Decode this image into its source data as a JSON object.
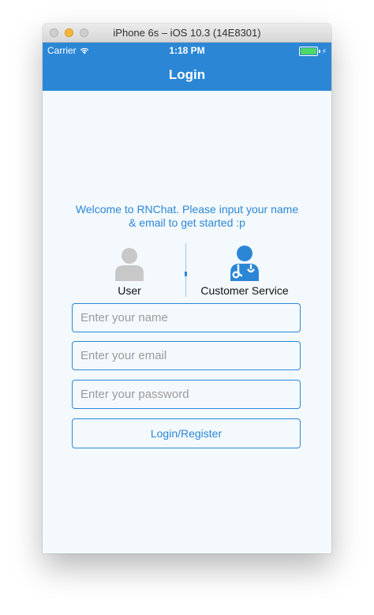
{
  "window": {
    "title": "iPhone 6s – iOS 10.3 (14E8301)"
  },
  "status_bar": {
    "carrier": "Carrier",
    "wifi_icon": "wifi-icon",
    "time": "1:18 PM",
    "battery_level": 1.0,
    "battery_icon": "battery-charging-icon"
  },
  "nav": {
    "title": "Login"
  },
  "welcome_text": "Welcome to RNChat. Please input your name & email to get started :p",
  "roles": {
    "user": {
      "label": "User",
      "icon": "user-icon",
      "selected": false
    },
    "customer_service": {
      "label": "Customer Service",
      "icon": "doctor-stethoscope-icon",
      "selected": true
    }
  },
  "form": {
    "name_placeholder": "Enter your name",
    "email_placeholder": "Enter your email",
    "password_placeholder": "Enter your password",
    "submit_label": "Login/Register"
  },
  "colors": {
    "accent": "#2b87d6",
    "background": "#f4f9fd",
    "inactive_icon": "#c8c8c8",
    "battery_fill": "#4cd964"
  }
}
